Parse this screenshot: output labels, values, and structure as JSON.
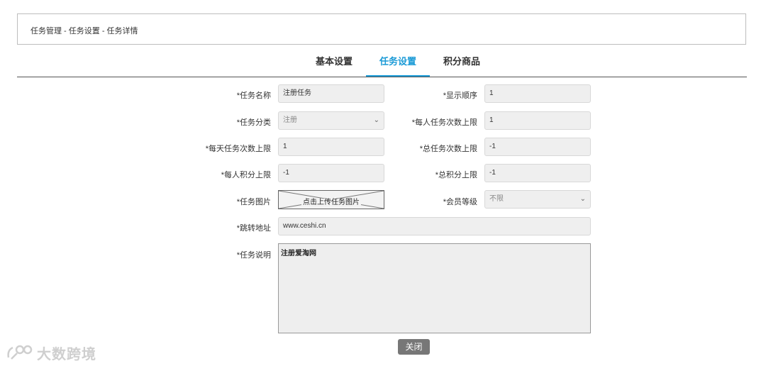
{
  "breadcrumb": "任务管理 - 任务设置 - 任务详情",
  "tabs": [
    {
      "label": "基本设置",
      "active": false
    },
    {
      "label": "任务设置",
      "active": true
    },
    {
      "label": "积分商品",
      "active": false
    }
  ],
  "form": {
    "task_name": {
      "label": "*任务名称",
      "value": "注册任务"
    },
    "display_order": {
      "label": "*显示顺序",
      "value": "1"
    },
    "task_category": {
      "label": "*任务分类",
      "value": "注册"
    },
    "per_person_limit": {
      "label": "*每人任务次数上限",
      "value": "1"
    },
    "daily_limit": {
      "label": "*每天任务次数上限",
      "value": "1"
    },
    "total_limit": {
      "label": "*总任务次数上限",
      "value": "-1"
    },
    "per_person_points": {
      "label": "*每人积分上限",
      "value": "-1"
    },
    "total_points": {
      "label": "*总积分上限",
      "value": "-1"
    },
    "task_image": {
      "label": "*任务图片",
      "button": "点击上传任务图片"
    },
    "member_level": {
      "label": "*会员等级",
      "value": "不限"
    },
    "redirect_url": {
      "label": "*跳转地址",
      "value": "www.ceshi.cn"
    },
    "description": {
      "label": "*任务说明",
      "value": "注册爱淘网"
    }
  },
  "close_label": "关闭",
  "watermark": "大数跨境",
  "colors": {
    "accent": "#1a9ad6",
    "field_bg": "#efefef",
    "button_bg": "#777777"
  }
}
